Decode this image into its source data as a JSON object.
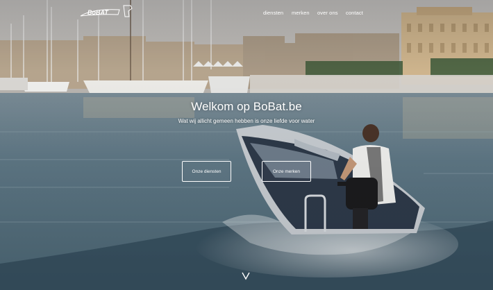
{
  "brand": {
    "logo_text": "BoBAT"
  },
  "nav": {
    "items": [
      {
        "label": "diensten"
      },
      {
        "label": "merken"
      },
      {
        "label": "over ons"
      },
      {
        "label": "contact"
      }
    ]
  },
  "hero": {
    "title": "Welkom op BoBat.be",
    "subtitle": "Wat wij allicht gemeen hebben is onze liefde voor water",
    "buttons": [
      {
        "label": "Onze diensten"
      },
      {
        "label": "Onze merken"
      }
    ],
    "scroll_icon": "chevron-down-icon"
  },
  "colors": {
    "water": "#5d7a88",
    "sky": "#c6c3c0",
    "text": "#ffffff"
  }
}
